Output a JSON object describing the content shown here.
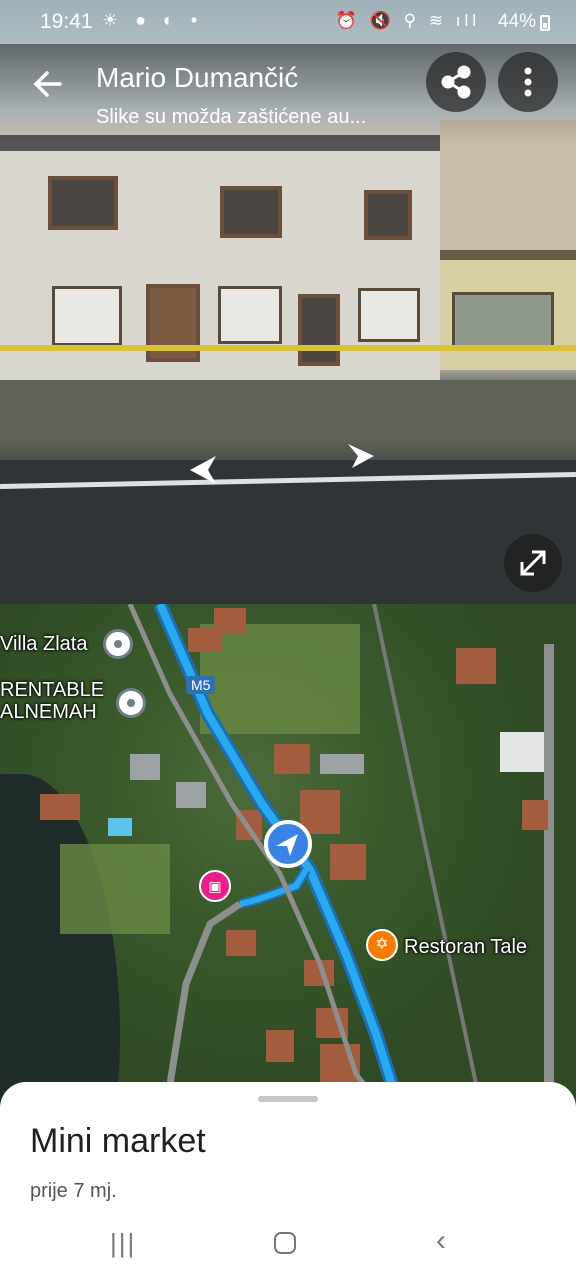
{
  "status_bar": {
    "time": "19:41",
    "left_icons": "☀ ● ◐ •",
    "right_icons": "⏰ 🔇 ⚲ ≋ ıll",
    "battery": "44%"
  },
  "header": {
    "title": "Mario Dumančić",
    "subtitle": "Slike su možda zaštićene au..."
  },
  "map": {
    "road_shield": "M5",
    "pois": [
      {
        "label": "Villa Zlata"
      },
      {
        "label": "RENTABLE\nALNEMAH"
      },
      {
        "label": "Restoran Tale"
      }
    ]
  },
  "sheet": {
    "title": "Mini market",
    "subtitle": "prije 7 mj."
  },
  "colors": {
    "route": "#29a9f0",
    "location": "#3b82e6",
    "hotel_pin": "#e91e8c",
    "restaurant_pin": "#f57c00"
  },
  "icons": {
    "back": "arrow-left-icon",
    "share": "share-icon",
    "more": "more-vertical-icon",
    "expand": "expand-icon",
    "nav_recents": "recents-icon",
    "nav_home": "home-icon",
    "nav_back": "chevron-left-icon"
  }
}
